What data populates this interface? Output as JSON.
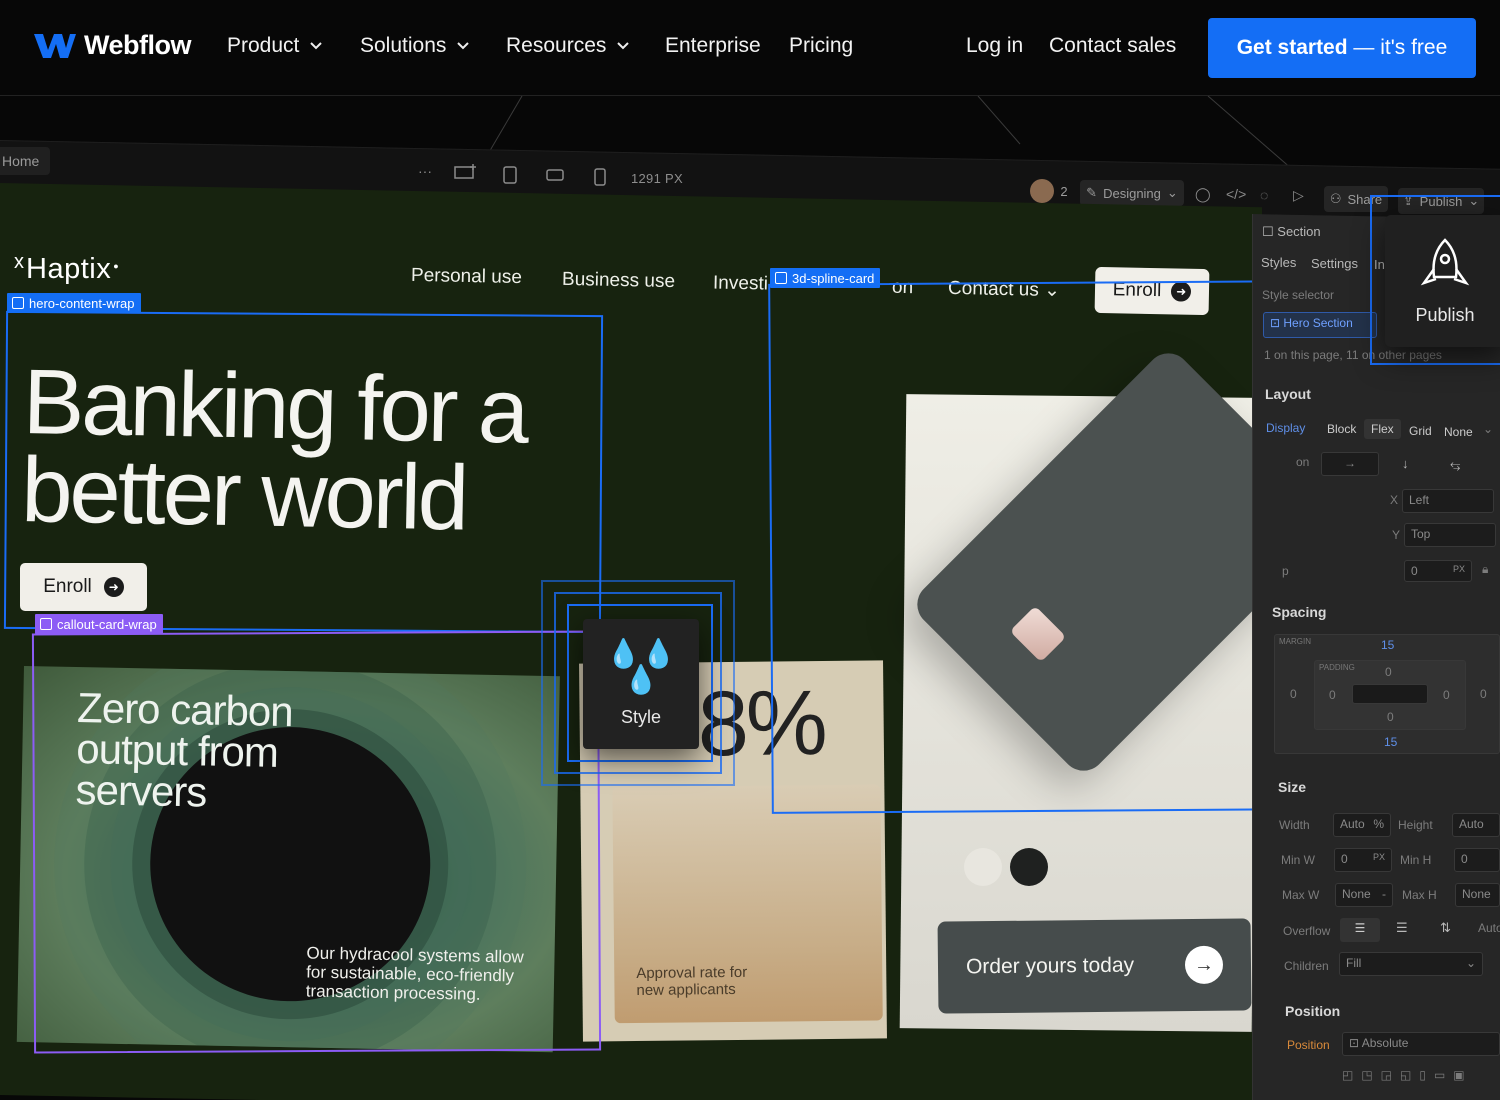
{
  "site_nav": {
    "brand": "Webflow",
    "items": [
      {
        "label": "Product",
        "has_menu": true
      },
      {
        "label": "Solutions",
        "has_menu": true
      },
      {
        "label": "Resources",
        "has_menu": true
      },
      {
        "label": "Enterprise",
        "has_menu": false
      },
      {
        "label": "Pricing",
        "has_menu": false
      }
    ],
    "login": "Log in",
    "contact": "Contact sales",
    "cta_bold": "Get started",
    "cta_rest": " — it's free",
    "cta_color": "#146ef5"
  },
  "designer": {
    "page_tab": "Home",
    "width_readout": "1291 PX",
    "collaborators": "2",
    "mode": "Designing",
    "share": "Share",
    "publish": "Publish"
  },
  "canvas_site": {
    "brand": "Haptix",
    "links": [
      "Personal use",
      "Business use",
      "Investi",
      "on",
      "Contact us"
    ],
    "enroll": "Enroll",
    "hero_line1": "Banking for a",
    "hero_line2": "better world",
    "callout_title": "Zero carbon output from servers",
    "callout_body": "Our hydracool systems allow for sustainable, eco-friendly transaction processing.",
    "stat_value": "8%",
    "stat_label": "Approval rate for new applicants",
    "order": "Order yours today",
    "swatch_colors": [
      "#e8e6df",
      "#1f2120"
    ]
  },
  "selections": {
    "hero": "hero-content-wrap",
    "callout": "callout-card-wrap",
    "spline": "3d-spline-card",
    "style_popup": "Style",
    "publish_popup": "Publish"
  },
  "style_panel": {
    "element_type": "Section",
    "tabs": [
      "Styles",
      "Settings",
      "In"
    ],
    "style_selector_label": "Style selector",
    "selector_value": "Hero Section",
    "selector_note": "1 on this page, 11 on other pages",
    "layout_head": "Layout",
    "display_label": "Display",
    "display_options": [
      "Block",
      "Flex",
      "Grid",
      "None"
    ],
    "direction_label": "on",
    "x_label": "X",
    "x_value": "Left",
    "y_label": "Y",
    "y_value": "Top",
    "gap_label": "p",
    "gap_value": "0",
    "gap_unit": "PX",
    "spacing_head": "Spacing",
    "margin_label": "MARGIN",
    "padding_label": "PADDING",
    "margin_top": "15",
    "margin_bottom": "15",
    "margin_left": "0",
    "margin_right": "0",
    "padding_top": "0",
    "padding_bottom": "0",
    "padding_left": "0",
    "padding_right": "0",
    "size_head": "Size",
    "width_label": "Width",
    "width_value": "Auto",
    "width_unit": "%",
    "height_label": "Height",
    "height_value": "Auto",
    "minw_label": "Min W",
    "minw_value": "0",
    "minw_unit": "PX",
    "minh_label": "Min H",
    "minh_value": "0",
    "maxw_label": "Max W",
    "maxw_value": "None",
    "maxw_unit": "-",
    "maxh_label": "Max H",
    "maxh_value": "None",
    "overflow_label": "Overflow",
    "overflow_auto": "Auto",
    "children_label": "Children",
    "children_value": "Fill",
    "position_head": "Position",
    "position_label": "Position",
    "position_value": "Absolute"
  }
}
